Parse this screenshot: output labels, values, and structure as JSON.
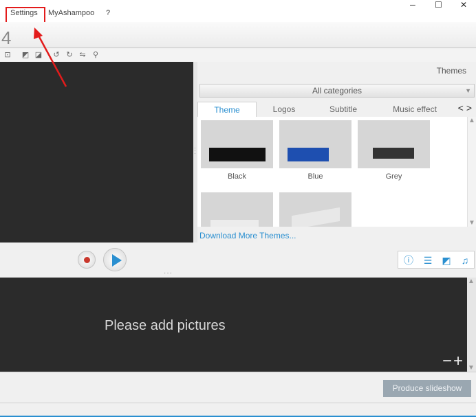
{
  "menu": {
    "settings": "Settings",
    "myashampoo": "MyAshampoo",
    "help": "?"
  },
  "window": {
    "minimize": "–",
    "maximize": "☐",
    "close": "✕"
  },
  "step": {
    "number": "4"
  },
  "themes": {
    "title": "Themes",
    "category": "All categories",
    "tabs": [
      "Theme",
      "Logos",
      "Subtitle",
      "Music effect"
    ],
    "items": [
      {
        "name": "Black",
        "bar_color": "#111111"
      },
      {
        "name": "Blue",
        "bar_color": "#1e4fb0"
      },
      {
        "name": "Grey",
        "bar_color": "#333333"
      },
      {
        "name": "",
        "bar_color": "#e8e8e8"
      },
      {
        "name": "",
        "bar_color": "#e8e8e8"
      }
    ],
    "download_link": "Download More Themes..."
  },
  "timeline": {
    "placeholder": "Please add pictures",
    "zoom": "−+"
  },
  "bottom": {
    "produce": "Produce slideshow"
  },
  "colors": {
    "accent": "#2a8fd0",
    "highlight": "#e31b1b",
    "record": "#c9372c"
  }
}
